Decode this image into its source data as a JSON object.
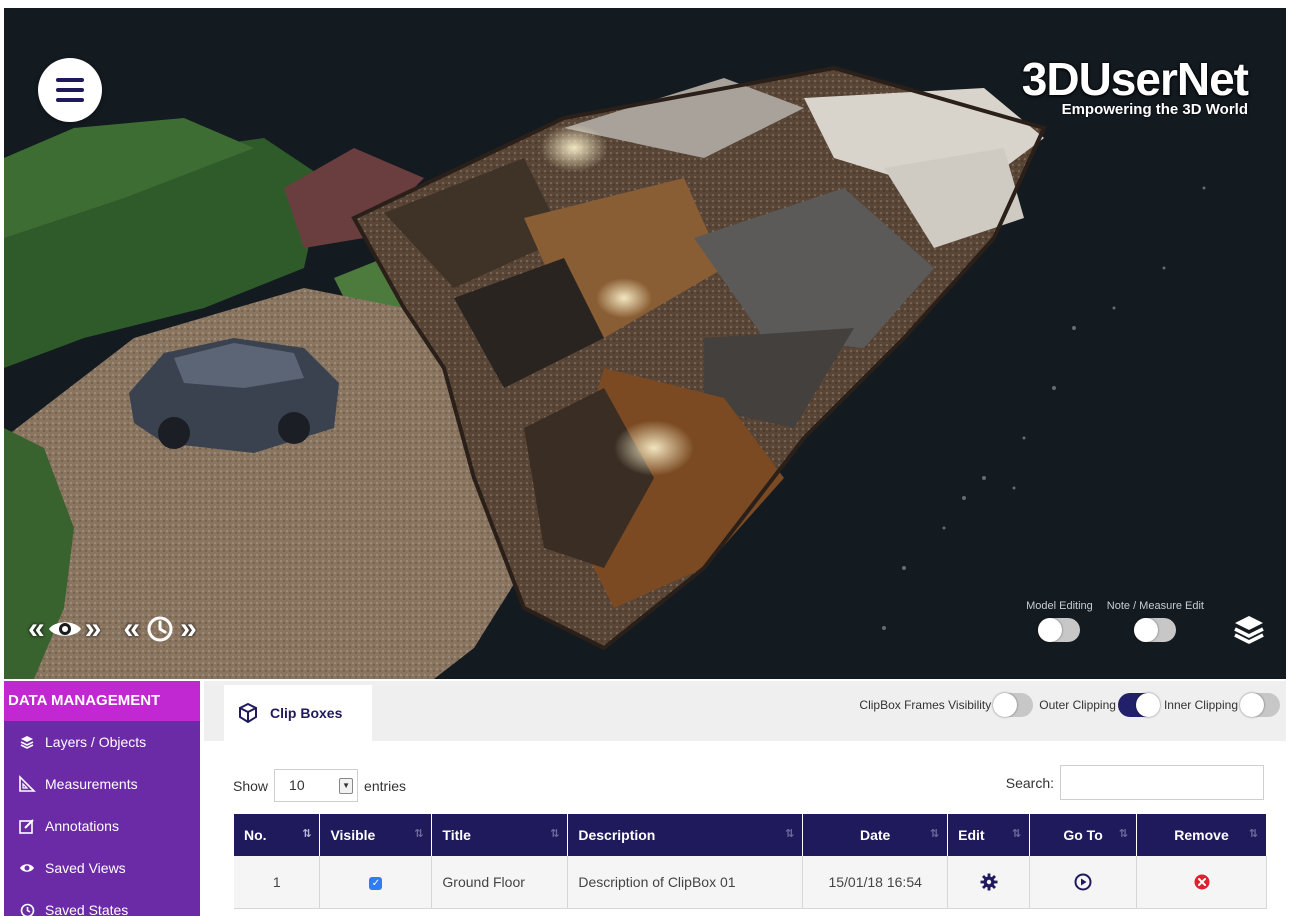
{
  "brand": {
    "name": "3DUserNet",
    "tagline": "Empowering the 3D World"
  },
  "viewer": {
    "menu_icon": "hamburger-icon",
    "nav_controls": [
      {
        "name": "eye-nav",
        "icon": "eye-icon",
        "prev": "«",
        "next": "»"
      },
      {
        "name": "clock-nav",
        "icon": "clock-icon",
        "prev": "«",
        "next": "»"
      }
    ],
    "toggles": [
      {
        "label": "Model Editing",
        "on": false
      },
      {
        "label": "Note / Measure Edit",
        "on": false
      }
    ],
    "layers_icon": "layers-icon"
  },
  "sidebar": {
    "title": "DATA MANAGEMENT",
    "items": [
      {
        "label": "Layers / Objects",
        "icon": "layers-icon"
      },
      {
        "label": "Measurements",
        "icon": "ruler-triangle-icon"
      },
      {
        "label": "Annotations",
        "icon": "edit-note-icon"
      },
      {
        "label": "Saved Views",
        "icon": "eye-icon"
      },
      {
        "label": "Saved States",
        "icon": "clock-icon"
      }
    ]
  },
  "tab": {
    "label": "Clip Boxes",
    "icon": "cube-icon"
  },
  "clip_toggles": [
    {
      "label": "ClipBox Frames Visibility",
      "on": false
    },
    {
      "label": "Outer Clipping",
      "on": true
    },
    {
      "label": "Inner Clipping",
      "on": false
    }
  ],
  "table_controls": {
    "show_label": "Show",
    "entries_value": "10",
    "entries_label": "entries",
    "search_label": "Search:",
    "search_value": ""
  },
  "table": {
    "columns": [
      "No.",
      "Visible",
      "Title",
      "Description",
      "Date",
      "Edit",
      "Go To",
      "Remove"
    ],
    "rows": [
      {
        "no": "1",
        "visible": true,
        "title": "Ground Floor",
        "description": "Description of ClipBox 01",
        "date": "15/01/18 16:54",
        "edit_icon": "gear-icon",
        "goto_icon": "play-circle-icon",
        "remove_icon": "remove-circle-icon"
      }
    ]
  },
  "colors": {
    "navy": "#1f1a5c",
    "sidebar_purple": "#6c2ba6",
    "sidebar_header_magenta": "#c228d2",
    "remove_red": "#e0202e",
    "checkbox_blue": "#2f7df6"
  }
}
